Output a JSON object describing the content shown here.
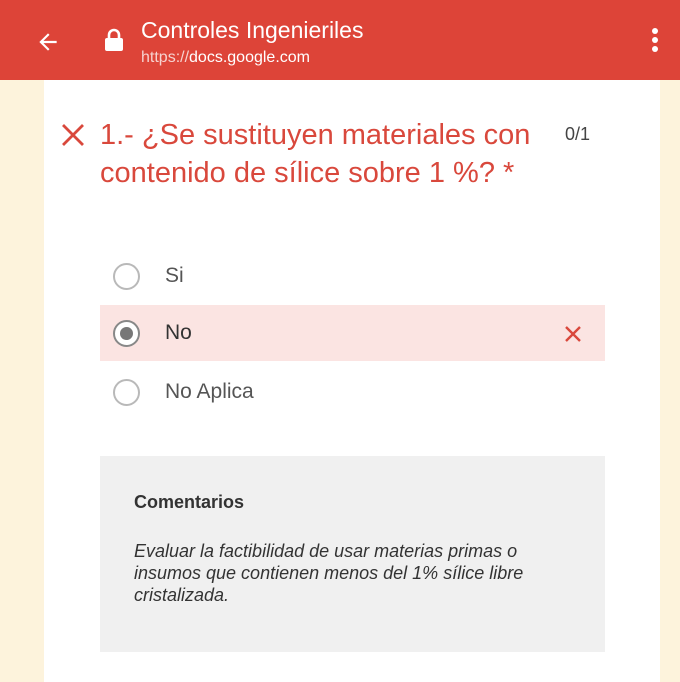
{
  "header": {
    "title": "Controles Ingenieriles",
    "url_scheme": "https://",
    "url_host": "docs.google.com",
    "bar_color": "#dd4438"
  },
  "question": {
    "text": "1.- ¿Se sustituyen materiales con contenido de sílice sobre 1 %? *",
    "score": "0/1",
    "result": "incorrect",
    "error_color": "#d9483c"
  },
  "options": [
    {
      "label": "Si",
      "selected": false
    },
    {
      "label": "No",
      "selected": true,
      "marked_wrong": true
    },
    {
      "label": "No Aplica",
      "selected": false
    }
  ],
  "feedback": {
    "title": "Comentarios",
    "text": "Evaluar la factibilidad de usar materias primas o insumos que contienen menos del 1% sílice libre cristalizada."
  },
  "icons": {
    "back": "arrow-left-icon",
    "lock": "lock-icon",
    "menu": "more-vert-icon",
    "wrong": "close-icon"
  }
}
